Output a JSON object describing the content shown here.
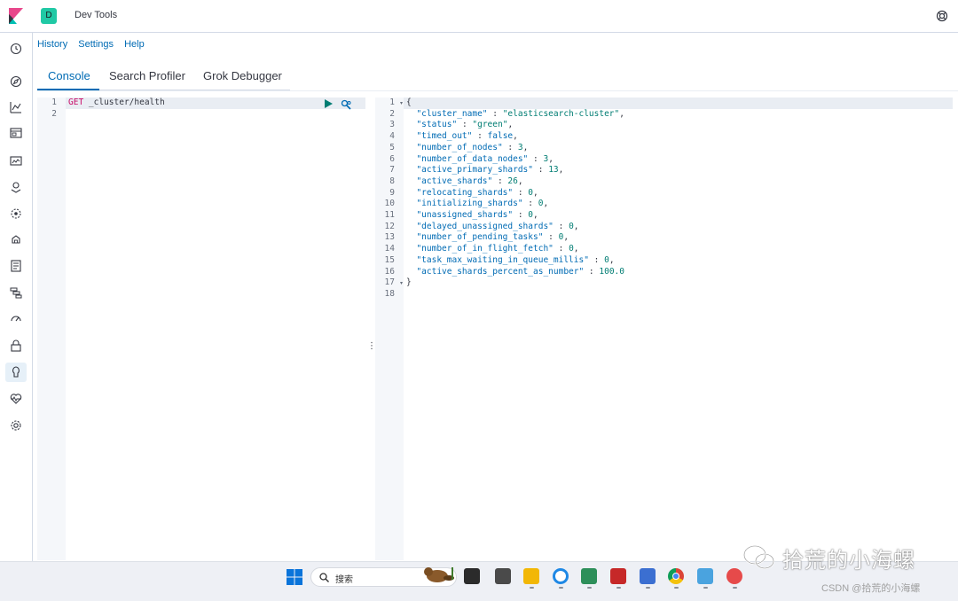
{
  "header": {
    "space_initial": "D",
    "app_title": "Dev Tools"
  },
  "nav_icons": [
    "clock-icon",
    "compass-icon",
    "chart-icon",
    "dashboard-icon",
    "canvas-icon",
    "maps-icon",
    "ml-icon",
    "infrastructure-icon",
    "logs-icon",
    "apm-icon",
    "uptime-icon",
    "siem-icon",
    "dev-tools-icon",
    "monitoring-icon",
    "management-icon"
  ],
  "top_menu": {
    "history": "History",
    "settings": "Settings",
    "help": "Help"
  },
  "tabs": [
    {
      "label": "Console"
    },
    {
      "label": "Search Profiler"
    },
    {
      "label": "Grok Debugger"
    }
  ],
  "request_editor": {
    "line_numbers": [
      "1",
      "2"
    ],
    "method": "GET",
    "path": "_cluster/health"
  },
  "response_editor": {
    "line_numbers": [
      "1",
      "2",
      "3",
      "4",
      "5",
      "6",
      "7",
      "8",
      "9",
      "10",
      "11",
      "12",
      "13",
      "14",
      "15",
      "16",
      "17",
      "18"
    ],
    "open_brace": "{",
    "close_brace": "}",
    "fields": [
      {
        "key": "\"cluster_name\"",
        "sep": " : ",
        "value": "\"elasticsearch-cluster\"",
        "type": "str",
        "trail": ","
      },
      {
        "key": "\"status\"",
        "sep": " : ",
        "value": "\"green\"",
        "type": "str",
        "trail": ","
      },
      {
        "key": "\"timed_out\"",
        "sep": " : ",
        "value": "false",
        "type": "bool",
        "trail": ","
      },
      {
        "key": "\"number_of_nodes\"",
        "sep": " : ",
        "value": "3",
        "type": "num",
        "trail": ","
      },
      {
        "key": "\"number_of_data_nodes\"",
        "sep": " : ",
        "value": "3",
        "type": "num",
        "trail": ","
      },
      {
        "key": "\"active_primary_shards\"",
        "sep": " : ",
        "value": "13",
        "type": "num",
        "trail": ","
      },
      {
        "key": "\"active_shards\"",
        "sep": " : ",
        "value": "26",
        "type": "num",
        "trail": ","
      },
      {
        "key": "\"relocating_shards\"",
        "sep": " : ",
        "value": "0",
        "type": "num",
        "trail": ","
      },
      {
        "key": "\"initializing_shards\"",
        "sep": " : ",
        "value": "0",
        "type": "num",
        "trail": ","
      },
      {
        "key": "\"unassigned_shards\"",
        "sep": " : ",
        "value": "0",
        "type": "num",
        "trail": ","
      },
      {
        "key": "\"delayed_unassigned_shards\"",
        "sep": " : ",
        "value": "0",
        "type": "num",
        "trail": ","
      },
      {
        "key": "\"number_of_pending_tasks\"",
        "sep": " : ",
        "value": "0",
        "type": "num",
        "trail": ","
      },
      {
        "key": "\"number_of_in_flight_fetch\"",
        "sep": " : ",
        "value": "0",
        "type": "num",
        "trail": ","
      },
      {
        "key": "\"task_max_waiting_in_queue_millis\"",
        "sep": " : ",
        "value": "0",
        "type": "num",
        "trail": ","
      },
      {
        "key": "\"active_shards_percent_as_number\"",
        "sep": " : ",
        "value": "100.0",
        "type": "num",
        "trail": ""
      }
    ]
  },
  "taskbar": {
    "search_label": "搜索",
    "apps": [
      "terminal-icon",
      "box-icon",
      "folder-icon",
      "edge-icon",
      "app-icon",
      "kali-icon",
      "notepad-icon",
      "chrome-icon",
      "photos-icon",
      "snail-icon"
    ]
  },
  "watermark": {
    "text": "拾荒的小海螺",
    "credit": "CSDN @拾荒的小海螺"
  },
  "colors": {
    "accent": "#006bb4",
    "space_badge": "#20c9a5",
    "method": "#c80a68",
    "string": "#017d73"
  }
}
